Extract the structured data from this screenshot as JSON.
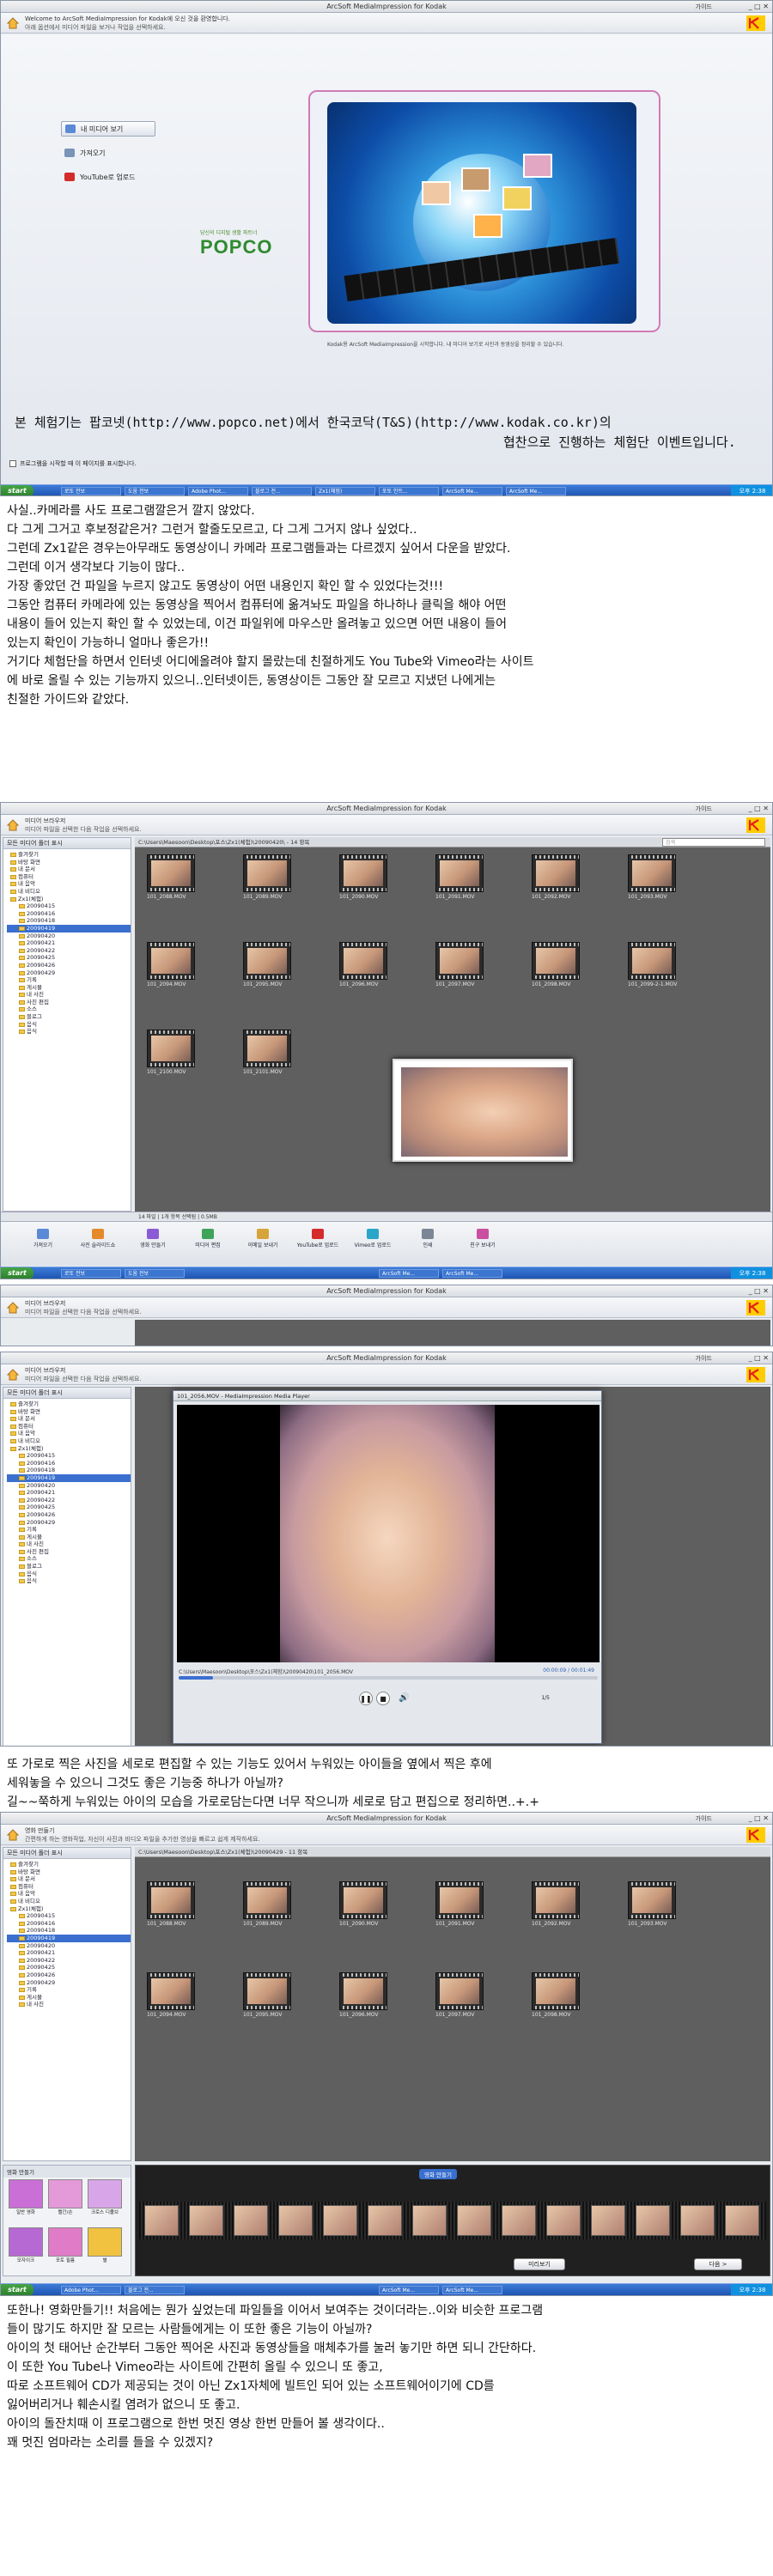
{
  "window": {
    "title": "ArcSoft MediaImpression for Kodak",
    "help": "가이드",
    "controls": "_ □ ✕"
  },
  "taskbar": {
    "start": "start",
    "items": [
      "로또 전보",
      "도움 전보",
      "Adobe Phot...",
      "블로그 전...",
      "Zx1(체험)",
      "포토 인트...",
      "ArcSoft Me...",
      "ArcSoft Me..."
    ],
    "clock": "오후 2:38"
  },
  "launcher": {
    "info_line1": "Welcome to ArcSoft MediaImpression for Kodak에 오신 것을 환영합니다.",
    "info_line2": "아래 옵션에서 미디어 파일을 보거나 작업을 선택하세요.",
    "menu": [
      "내 미디어 보기",
      "가져오기",
      "YouTube로 업로드"
    ],
    "popco_tagline": "당신의 디지털 생활 파트너",
    "popco": "POPCO",
    "footer_note": "Kodak용 ArcSoft MediaImpression을 시작합니다. 내 미디어 보기로 사진과 동영상을 정리할 수 있습니다.",
    "promo_line1": "본 체험기는 팝코넷(http://www.popco.net)에서 한국코닥(T&S)(http://www.kodak.co.kr)의",
    "promo_line2": "협찬으로 진행하는 체험단 이벤트입니다.",
    "checkbox": "프로그램을 시작할 때 이 페이지를 표시합니다."
  },
  "para1": [
    "사실..카메라를 사도 프로그램깔은거 깔지 않았다.",
    "다 그게 그거고 후보정같은거? 그런거 할줄도모르고, 다 그게 그거지 않나 싶었다..",
    "그런데 Zx1같은 경우는아무래도 동영상이니  카메라 프로그램들과는 다르겠지 싶어서 다운을 받았다.",
    "그런데 이거 생각보다 기능이 많다..",
    "가장 좋았던 건 파일을 누르지 않고도 동영상이 어떤 내용인지 확인 할 수 있었다는것!!!",
    "그동안 컴퓨터 카메라에 있는 동영상을 찍어서 컴퓨터에 옮겨놔도 파일을 하나하나 클릭을 해야 어떤",
    "내용이 들어 있는지 확인 할 수 있었는데, 이건 파일위에 마우스만 올려놓고 있으면 어떤 내용이 들어",
    "있는지 확인이 가능하니 얼마나 좋은가!!",
    "거기다 체험단을 하면서 인터넷 어디에올려야 할지 몰랐는데 친절하게도 You Tube와 Vimeo라는 사이트",
    "에 바로 올릴 수 있는 기능까지 있으니..인터넷이든, 동영상이든 그동안 잘 모르고 지냈던 나에게는",
    "친절한 가이드와 같았다."
  ],
  "browser": {
    "info_line1": "미디어 브라우저",
    "info_line2": "미디어 파일을 선택한 다음 작업을 선택하세요.",
    "side_header": "모든 미디어 폴더 표시",
    "tree": [
      "즐겨찾기",
      "바탕 화면",
      "내 문서",
      "컴퓨터",
      "내 음악",
      "내 비디오",
      "Zx1(체험)",
      "20090415",
      "20090416",
      "20090418",
      "20090419",
      "20090420",
      "20090421",
      "20090422",
      "20090425",
      "20090426",
      "20090429",
      "기록",
      "게시물",
      "내 사진",
      "사진 편집",
      "소스",
      "블로그",
      "음식",
      "음식"
    ],
    "selected_index": 10,
    "path": "C:\\Users\\Maesoon\\Desktop\\포스\\Zx1(체험)\\20090420\\ - 14 항목",
    "search": "검색",
    "thumbs": [
      "101_2088.MOV",
      "101_2089.MOV",
      "101_2090.MOV",
      "101_2091.MOV",
      "101_2092.MOV",
      "101_2093.MOV",
      "101_2094.MOV",
      "101_2095.MOV",
      "101_2096.MOV",
      "101_2097.MOV",
      "101_2098.MOV",
      "101_2099-2-1.MOV",
      "101_2100.MOV",
      "101_2101.MOV"
    ],
    "status": "14 파일 | 1개 항목 선택됨 | 0.5MB",
    "tools": [
      "가져오기",
      "사진 슬라이드쇼",
      "영화 만들기",
      "미디어 편집",
      "이메일 보내기",
      "YouTube로 업로드",
      "Vimeo로 업로드",
      "인쇄",
      "친구 보내기"
    ]
  },
  "player": {
    "title": "101_2056.MOV - MediaImpression Media Player",
    "path": "C:\\Users\\Maesoon\\Desktop\\포스\\Zx1(체험)\\20090420\\101_2056.MOV",
    "time": "00:00:09 / 00:01:49",
    "page": "1/5"
  },
  "para2": [
    "또 가로로 찍은 사진을 세로로 편집할 수 있는 기능도 있어서 누워있는 아이들을 옆에서 찍은 후에",
    "세워놓을 수 있으니 그것도 좋은 기능중 하나가 아닐까?",
    "길~~쭉하게 누워있는 아이의 모습을 가로로담는다면 너무 작으니까 세로로 담고 편집으로 정리하면..+.+"
  ],
  "moviemaker": {
    "info_line1": "영화 만들기",
    "info_line2": "간편하게 하는 영화작업, 자신이 사진과 비디오 파일을 추가한 영상을 빠르고 쉽게 제작하세요.",
    "path": "C:\\Users\\Maesoon\\Desktop\\포스\\Zx1(체험)\\20090429 - 11 항목",
    "styles_label": "영화 만들기",
    "styles": [
      "일반 영화",
      "빨간/손",
      "크로스 디졸브",
      "모자이크",
      "포토 필름",
      "별"
    ],
    "timeline_label": "영화 만들기",
    "preview_button": "미리보기",
    "next_button": "다음 >"
  },
  "para3": [
    "또한나! 영화만들기!! 처음에는 뭔가 싶었는데 파일들을 이어서 보여주는 것이더라는..이와 비슷한 프로그램",
    "들이 많기도 하지만 잘 모르는 사람들에게는 이 또한 좋은 기능이 아닐까?",
    "아이의 첫 태어난 순간부터 그동안 찍어온 사진과 동영상들을 매체추가를 눌러 놓기만 하면 되니 간단하다.",
    "이 또한 You Tube나 Vimeo라는 사이트에 간편히 올릴 수 있으니 또 좋고,",
    "따로 소프트웨어 CD가 제공되는 것이 아닌 Zx1자체에 빌트인 되어 있는 소프트웨어이기에 CD를",
    "잃어버리거나 훼손시킬 염려가 없으니 또 좋고.",
    "아이의 돌잔치때 이 프로그램으로 한번 멋진 영상 한번 만들어 볼 생각이다..",
    "꽤 멋진 엄마라는 소리를 들을 수 있겠지?"
  ]
}
